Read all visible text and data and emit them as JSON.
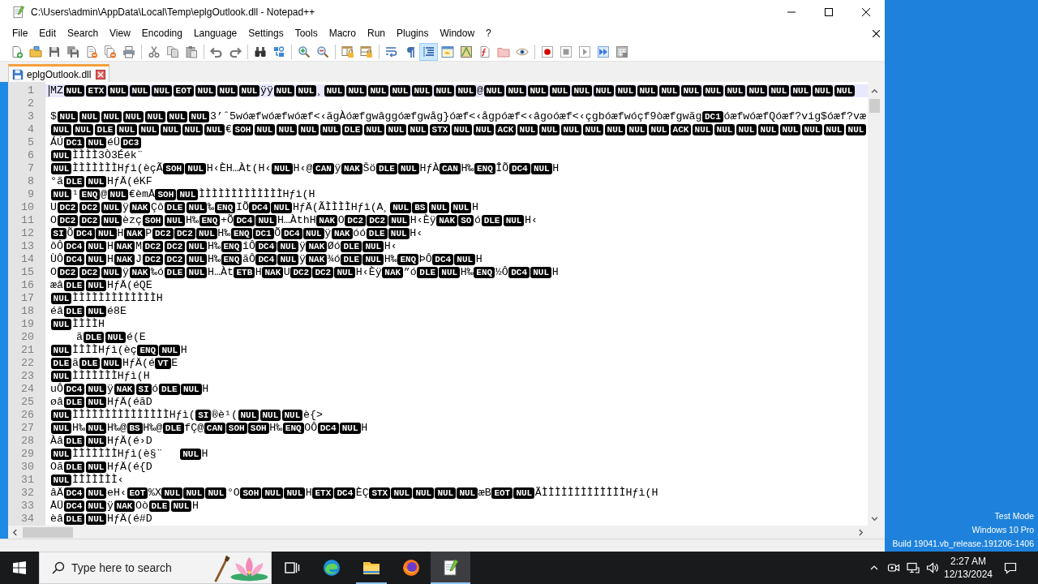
{
  "window": {
    "title": "C:\\Users\\admin\\AppData\\Local\\Temp\\eplgOutlook.dll - Notepad++"
  },
  "menu": [
    "File",
    "Edit",
    "Search",
    "View",
    "Encoding",
    "Language",
    "Settings",
    "Tools",
    "Macro",
    "Run",
    "Plugins",
    "Window",
    "?"
  ],
  "toolbar": [
    {
      "on": false
    },
    {
      "on": false
    },
    {
      "on": false
    },
    {
      "on": false
    },
    {
      "on": false
    },
    {
      "on": false
    },
    {
      "on": false
    },
    {
      "on": false
    },
    {
      "on": false
    },
    {
      "on": false
    },
    {
      "on": false
    },
    {
      "on": false
    },
    {
      "on": false
    },
    {
      "on": false
    },
    {
      "on": false
    },
    {
      "on": false
    },
    {
      "on": false
    },
    {
      "on": false
    },
    {
      "on": false
    },
    {
      "on": false
    },
    {
      "on": true
    },
    {
      "on": false
    },
    {
      "on": false
    },
    {
      "on": false
    },
    {
      "on": false
    },
    {
      "on": false
    },
    {
      "on": false
    },
    {
      "on": false
    },
    {
      "on": false
    },
    {
      "on": false
    },
    {
      "on": false
    }
  ],
  "tabs": [
    {
      "label": "eplgOutlook.dll",
      "selected": true
    }
  ],
  "editor": {
    "lines": [
      {
        "number": "1",
        "current": true,
        "segments": [
          {
            "kind": "text",
            "text": "MZ"
          },
          {
            "kind": "ctrl",
            "text": "NUL"
          },
          {
            "kind": "ctrl",
            "text": "ETX"
          },
          {
            "kind": "ctrl",
            "text": "NUL"
          },
          {
            "kind": "ctrl",
            "text": "NUL"
          },
          {
            "kind": "ctrl",
            "text": "NUL"
          },
          {
            "kind": "ctrl",
            "text": "EOT"
          },
          {
            "kind": "ctrl",
            "text": "NUL"
          },
          {
            "kind": "ctrl",
            "text": "NUL"
          },
          {
            "kind": "ctrl",
            "text": "NUL"
          },
          {
            "kind": "text",
            "text": "ÿÿ"
          },
          {
            "kind": "ctrl",
            "text": "NUL"
          },
          {
            "kind": "ctrl",
            "text": "NUL"
          },
          {
            "kind": "text",
            "text": "¸"
          },
          {
            "kind": "ctrl",
            "text": "NUL"
          },
          {
            "kind": "ctrl",
            "text": "NUL"
          },
          {
            "kind": "ctrl",
            "text": "NUL"
          },
          {
            "kind": "ctrl",
            "text": "NUL"
          },
          {
            "kind": "ctrl",
            "text": "NUL"
          },
          {
            "kind": "ctrl",
            "text": "NUL"
          },
          {
            "kind": "ctrl",
            "text": "NUL"
          },
          {
            "kind": "text",
            "text": "@"
          },
          {
            "kind": "ctrl",
            "text": "NUL"
          },
          {
            "kind": "ctrl",
            "text": "NUL"
          },
          {
            "kind": "ctrl",
            "text": "NUL"
          },
          {
            "kind": "ctrl",
            "text": "NUL"
          },
          {
            "kind": "ctrl",
            "text": "NUL"
          },
          {
            "kind": "ctrl",
            "text": "NUL"
          },
          {
            "kind": "ctrl",
            "text": "NUL"
          },
          {
            "kind": "ctrl",
            "text": "NUL"
          },
          {
            "kind": "ctrl",
            "text": "NUL"
          },
          {
            "kind": "ctrl",
            "text": "NUL"
          },
          {
            "kind": "ctrl",
            "text": "NUL"
          },
          {
            "kind": "ctrl",
            "text": "NUL"
          },
          {
            "kind": "ctrl",
            "text": "NUL"
          },
          {
            "kind": "ctrl",
            "text": "NUL"
          },
          {
            "kind": "ctrl",
            "text": "NUL"
          },
          {
            "kind": "ctrl",
            "text": "NUL"
          },
          {
            "kind": "ctrl",
            "text": "NUL"
          }
        ]
      },
      {
        "number": "2",
        "current": false
      },
      {
        "number": "3",
        "current": false,
        "segments": [
          {
            "kind": "text",
            "text": "$"
          },
          {
            "kind": "ctrl",
            "text": "NUL"
          },
          {
            "kind": "ctrl",
            "text": "NUL"
          },
          {
            "kind": "ctrl",
            "text": "NUL"
          },
          {
            "kind": "ctrl",
            "text": "NUL"
          },
          {
            "kind": "ctrl",
            "text": "NUL"
          },
          {
            "kind": "ctrl",
            "text": "NUL"
          },
          {
            "kind": "ctrl",
            "text": "NUL"
          },
          {
            "kind": "text",
            "text": "3’ˆ5wóæfwóæfwóæf<‹ãgÀóæfgwâggóæfgwåg}óæf<‹ågpóæf<‹âgoóæf<‹çgbóæfwóçf9òæfgwãg"
          },
          {
            "kind": "ctrl",
            "text": "DC1"
          },
          {
            "kind": "text",
            "text": "óæfwóæfQóæf?vig$óæf?væ"
          }
        ]
      },
      {
        "number": "4",
        "current": false,
        "segments": [
          {
            "kind": "ctrl",
            "text": "NUL"
          },
          {
            "kind": "ctrl",
            "text": "NUL"
          },
          {
            "kind": "ctrl",
            "text": "DLE"
          },
          {
            "kind": "ctrl",
            "text": "NUL"
          },
          {
            "kind": "ctrl",
            "text": "NUL"
          },
          {
            "kind": "ctrl",
            "text": "NUL"
          },
          {
            "kind": "ctrl",
            "text": "NUL"
          },
          {
            "kind": "ctrl",
            "text": "NUL"
          },
          {
            "kind": "text",
            "text": "€"
          },
          {
            "kind": "ctrl",
            "text": "SOH"
          },
          {
            "kind": "ctrl",
            "text": "NUL"
          },
          {
            "kind": "ctrl",
            "text": "NUL"
          },
          {
            "kind": "ctrl",
            "text": "NUL"
          },
          {
            "kind": "ctrl",
            "text": "NUL"
          },
          {
            "kind": "ctrl",
            "text": "DLE"
          },
          {
            "kind": "ctrl",
            "text": "NUL"
          },
          {
            "kind": "ctrl",
            "text": "NUL"
          },
          {
            "kind": "ctrl",
            "text": "NUL"
          },
          {
            "kind": "ctrl",
            "text": "STX"
          },
          {
            "kind": "ctrl",
            "text": "NUL"
          },
          {
            "kind": "ctrl",
            "text": "NUL"
          },
          {
            "kind": "ctrl",
            "text": "ACK"
          },
          {
            "kind": "ctrl",
            "text": "NUL"
          },
          {
            "kind": "ctrl",
            "text": "NUL"
          },
          {
            "kind": "ctrl",
            "text": "NUL"
          },
          {
            "kind": "ctrl",
            "text": "NUL"
          },
          {
            "kind": "ctrl",
            "text": "NUL"
          },
          {
            "kind": "ctrl",
            "text": "NUL"
          },
          {
            "kind": "ctrl",
            "text": "NUL"
          },
          {
            "kind": "ctrl",
            "text": "ACK"
          },
          {
            "kind": "ctrl",
            "text": "NUL"
          },
          {
            "kind": "ctrl",
            "text": "NUL"
          },
          {
            "kind": "ctrl",
            "text": "NUL"
          },
          {
            "kind": "ctrl",
            "text": "NUL"
          },
          {
            "kind": "ctrl",
            "text": "NUL"
          },
          {
            "kind": "ctrl",
            "text": "NUL"
          },
          {
            "kind": "ctrl",
            "text": "NUL"
          },
          {
            "kind": "ctrl",
            "text": "NUL"
          }
        ]
      },
      {
        "number": "5",
        "current": false,
        "segments": [
          {
            "kind": "text",
            "text": "ÁÚ"
          },
          {
            "kind": "ctrl",
            "text": "DC1"
          },
          {
            "kind": "ctrl",
            "text": "NUL"
          },
          {
            "kind": "text",
            "text": "éÜ"
          },
          {
            "kind": "ctrl",
            "text": "DC3"
          }
        ]
      },
      {
        "number": "6",
        "current": false,
        "segments": [
          {
            "kind": "ctrl",
            "text": "NUL"
          },
          {
            "kind": "text",
            "text": "ÌÌÌÌ3Ò3Éék¨"
          }
        ]
      },
      {
        "number": "7",
        "current": false,
        "segments": [
          {
            "kind": "ctrl",
            "text": "NUL"
          },
          {
            "kind": "text",
            "text": "ÌÌÌÌÌÌÌHƒì(èçÃ"
          },
          {
            "kind": "ctrl",
            "text": "SOH"
          },
          {
            "kind": "ctrl",
            "text": "NUL"
          },
          {
            "kind": "text",
            "text": "H‹ÈH…Àt(H‹"
          },
          {
            "kind": "ctrl",
            "text": "NUL"
          },
          {
            "kind": "text",
            "text": "H‹@"
          },
          {
            "kind": "ctrl",
            "text": "CAN"
          },
          {
            "kind": "text",
            "text": "ÿ"
          },
          {
            "kind": "ctrl",
            "text": "NAK"
          },
          {
            "kind": "text",
            "text": "Šö"
          },
          {
            "kind": "ctrl",
            "text": "DLE"
          },
          {
            "kind": "ctrl",
            "text": "NUL"
          },
          {
            "kind": "text",
            "text": "HƒÀ"
          },
          {
            "kind": "ctrl",
            "text": "CAN"
          },
          {
            "kind": "text",
            "text": "H‰"
          },
          {
            "kind": "ctrl",
            "text": "ENQ"
          },
          {
            "kind": "text",
            "text": "ÎÕ"
          },
          {
            "kind": "ctrl",
            "text": "DC4"
          },
          {
            "kind": "ctrl",
            "text": "NUL"
          },
          {
            "kind": "text",
            "text": "H"
          }
        ]
      },
      {
        "number": "8",
        "current": false,
        "segments": [
          {
            "kind": "text",
            "text": "°ã"
          },
          {
            "kind": "ctrl",
            "text": "DLE"
          },
          {
            "kind": "ctrl",
            "text": "NUL"
          },
          {
            "kind": "text",
            "text": "HƒÄ(éKF"
          }
        ]
      },
      {
        "number": "9",
        "current": false,
        "segments": [
          {
            "kind": "ctrl",
            "text": "NUL"
          },
          {
            "kind": "text",
            "text": "¹"
          },
          {
            "kind": "ctrl",
            "text": "ENQ"
          },
          {
            "kind": "text",
            "text": "@"
          },
          {
            "kind": "ctrl",
            "text": "NUL"
          },
          {
            "kind": "text",
            "text": "€èmÅ"
          },
          {
            "kind": "ctrl",
            "text": "SOH"
          },
          {
            "kind": "ctrl",
            "text": "NUL"
          },
          {
            "kind": "text",
            "text": "ÌÌÌÌÌÌÌÌÌÌÌÌÌHƒì(H"
          }
        ]
      },
      {
        "number": "10",
        "current": false,
        "segments": [
          {
            "kind": "text",
            "text": "U"
          },
          {
            "kind": "ctrl",
            "text": "DC2"
          },
          {
            "kind": "ctrl",
            "text": "DC2"
          },
          {
            "kind": "ctrl",
            "text": "NUL"
          },
          {
            "kind": "text",
            "text": "ÿ"
          },
          {
            "kind": "ctrl",
            "text": "NAK"
          },
          {
            "kind": "text",
            "text": "Çô"
          },
          {
            "kind": "ctrl",
            "text": "DLE"
          },
          {
            "kind": "ctrl",
            "text": "NUL"
          },
          {
            "kind": "text",
            "text": "‰"
          },
          {
            "kind": "ctrl",
            "text": "ENQ"
          },
          {
            "kind": "text",
            "text": "IÕ"
          },
          {
            "kind": "ctrl",
            "text": "DC4"
          },
          {
            "kind": "ctrl",
            "text": "NUL"
          },
          {
            "kind": "text",
            "text": "HƒÄ(ÃÌÌÌÌHƒì(A¸"
          },
          {
            "kind": "ctrl",
            "text": "NUL"
          },
          {
            "kind": "ctrl",
            "text": "BS"
          },
          {
            "kind": "ctrl",
            "text": "NUL"
          },
          {
            "kind": "ctrl",
            "text": "NUL"
          },
          {
            "kind": "text",
            "text": "H"
          }
        ]
      },
      {
        "number": "11",
        "current": false,
        "segments": [
          {
            "kind": "text",
            "text": "O"
          },
          {
            "kind": "ctrl",
            "text": "DC2"
          },
          {
            "kind": "ctrl",
            "text": "DC2"
          },
          {
            "kind": "ctrl",
            "text": "NUL"
          },
          {
            "kind": "text",
            "text": "èzç"
          },
          {
            "kind": "ctrl",
            "text": "SOH"
          },
          {
            "kind": "ctrl",
            "text": "NUL"
          },
          {
            "kind": "text",
            "text": "H‰"
          },
          {
            "kind": "ctrl",
            "text": "ENQ"
          },
          {
            "kind": "text",
            "text": "+Õ"
          },
          {
            "kind": "ctrl",
            "text": "DC4"
          },
          {
            "kind": "ctrl",
            "text": "NUL"
          },
          {
            "kind": "text",
            "text": "H…ÀthH"
          },
          {
            "kind": "ctrl",
            "text": "NAK"
          },
          {
            "kind": "text",
            "text": "O"
          },
          {
            "kind": "ctrl",
            "text": "DC2"
          },
          {
            "kind": "ctrl",
            "text": "DC2"
          },
          {
            "kind": "ctrl",
            "text": "NUL"
          },
          {
            "kind": "text",
            "text": "H‹Èÿ"
          },
          {
            "kind": "ctrl",
            "text": "NAK"
          },
          {
            "kind": "ctrl",
            "text": "SO"
          },
          {
            "kind": "text",
            "text": "ó"
          },
          {
            "kind": "ctrl",
            "text": "DLE"
          },
          {
            "kind": "ctrl",
            "text": "NUL"
          },
          {
            "kind": "text",
            "text": "H‹"
          }
        ]
      },
      {
        "number": "12",
        "current": false,
        "segments": [
          {
            "kind": "ctrl",
            "text": "SI"
          },
          {
            "kind": "text",
            "text": "Õ"
          },
          {
            "kind": "ctrl",
            "text": "DC4"
          },
          {
            "kind": "ctrl",
            "text": "NUL"
          },
          {
            "kind": "text",
            "text": "H"
          },
          {
            "kind": "ctrl",
            "text": "NAK"
          },
          {
            "kind": "text",
            "text": "P"
          },
          {
            "kind": "ctrl",
            "text": "DC2"
          },
          {
            "kind": "ctrl",
            "text": "DC2"
          },
          {
            "kind": "ctrl",
            "text": "NUL"
          },
          {
            "kind": "text",
            "text": "H‰"
          },
          {
            "kind": "ctrl",
            "text": "ENQ"
          },
          {
            "kind": "ctrl",
            "text": "DC1"
          },
          {
            "kind": "text",
            "text": "Õ"
          },
          {
            "kind": "ctrl",
            "text": "DC4"
          },
          {
            "kind": "ctrl",
            "text": "NUL"
          },
          {
            "kind": "text",
            "text": "ÿ"
          },
          {
            "kind": "ctrl",
            "text": "NAK"
          },
          {
            "kind": "text",
            "text": "óó"
          },
          {
            "kind": "ctrl",
            "text": "DLE"
          },
          {
            "kind": "ctrl",
            "text": "NUL"
          },
          {
            "kind": "text",
            "text": "H‹"
          }
        ]
      },
      {
        "number": "13",
        "current": false,
        "segments": [
          {
            "kind": "text",
            "text": "ôÔ"
          },
          {
            "kind": "ctrl",
            "text": "DC4"
          },
          {
            "kind": "ctrl",
            "text": "NUL"
          },
          {
            "kind": "text",
            "text": "H"
          },
          {
            "kind": "ctrl",
            "text": "NAK"
          },
          {
            "kind": "text",
            "text": "M"
          },
          {
            "kind": "ctrl",
            "text": "DC2"
          },
          {
            "kind": "ctrl",
            "text": "DC2"
          },
          {
            "kind": "ctrl",
            "text": "NUL"
          },
          {
            "kind": "text",
            "text": "H‰"
          },
          {
            "kind": "ctrl",
            "text": "ENQ"
          },
          {
            "kind": "text",
            "text": "îÔ"
          },
          {
            "kind": "ctrl",
            "text": "DC4"
          },
          {
            "kind": "ctrl",
            "text": "NUL"
          },
          {
            "kind": "text",
            "text": "ÿ"
          },
          {
            "kind": "ctrl",
            "text": "NAK"
          },
          {
            "kind": "text",
            "text": "Øó"
          },
          {
            "kind": "ctrl",
            "text": "DLE"
          },
          {
            "kind": "ctrl",
            "text": "NUL"
          },
          {
            "kind": "text",
            "text": "H‹"
          }
        ]
      },
      {
        "number": "14",
        "current": false,
        "segments": [
          {
            "kind": "text",
            "text": "ÙÔ"
          },
          {
            "kind": "ctrl",
            "text": "DC4"
          },
          {
            "kind": "ctrl",
            "text": "NUL"
          },
          {
            "kind": "text",
            "text": "H"
          },
          {
            "kind": "ctrl",
            "text": "NAK"
          },
          {
            "kind": "text",
            "text": "J"
          },
          {
            "kind": "ctrl",
            "text": "DC2"
          },
          {
            "kind": "ctrl",
            "text": "DC2"
          },
          {
            "kind": "ctrl",
            "text": "NUL"
          },
          {
            "kind": "text",
            "text": "H‰"
          },
          {
            "kind": "ctrl",
            "text": "ENQ"
          },
          {
            "kind": "text",
            "text": "ãÔ"
          },
          {
            "kind": "ctrl",
            "text": "DC4"
          },
          {
            "kind": "ctrl",
            "text": "NUL"
          },
          {
            "kind": "text",
            "text": "ÿ"
          },
          {
            "kind": "ctrl",
            "text": "NAK"
          },
          {
            "kind": "text",
            "text": "¾ó"
          },
          {
            "kind": "ctrl",
            "text": "DLE"
          },
          {
            "kind": "ctrl",
            "text": "NUL"
          },
          {
            "kind": "text",
            "text": "H‰"
          },
          {
            "kind": "ctrl",
            "text": "ENQ"
          },
          {
            "kind": "text",
            "text": "ÞÔ"
          },
          {
            "kind": "ctrl",
            "text": "DC4"
          },
          {
            "kind": "ctrl",
            "text": "NUL"
          },
          {
            "kind": "text",
            "text": "H"
          }
        ]
      },
      {
        "number": "15",
        "current": false,
        "segments": [
          {
            "kind": "text",
            "text": "O"
          },
          {
            "kind": "ctrl",
            "text": "DC2"
          },
          {
            "kind": "ctrl",
            "text": "DC2"
          },
          {
            "kind": "ctrl",
            "text": "NUL"
          },
          {
            "kind": "text",
            "text": "ÿ"
          },
          {
            "kind": "ctrl",
            "text": "NAK"
          },
          {
            "kind": "text",
            "text": "‰ó"
          },
          {
            "kind": "ctrl",
            "text": "DLE"
          },
          {
            "kind": "ctrl",
            "text": "NUL"
          },
          {
            "kind": "text",
            "text": "H…Àt"
          },
          {
            "kind": "ctrl",
            "text": "ETB"
          },
          {
            "kind": "text",
            "text": "H"
          },
          {
            "kind": "ctrl",
            "text": "NAK"
          },
          {
            "kind": "text",
            "text": "U"
          },
          {
            "kind": "ctrl",
            "text": "DC2"
          },
          {
            "kind": "ctrl",
            "text": "DC2"
          },
          {
            "kind": "ctrl",
            "text": "NUL"
          },
          {
            "kind": "text",
            "text": "H‹Èÿ"
          },
          {
            "kind": "ctrl",
            "text": "NAK"
          },
          {
            "kind": "text",
            "text": "”ó"
          },
          {
            "kind": "ctrl",
            "text": "DLE"
          },
          {
            "kind": "ctrl",
            "text": "NUL"
          },
          {
            "kind": "text",
            "text": "H‰"
          },
          {
            "kind": "ctrl",
            "text": "ENQ"
          },
          {
            "kind": "text",
            "text": "½Ô"
          },
          {
            "kind": "ctrl",
            "text": "DC4"
          },
          {
            "kind": "ctrl",
            "text": "NUL"
          },
          {
            "kind": "text",
            "text": "H"
          }
        ]
      },
      {
        "number": "16",
        "current": false,
        "segments": [
          {
            "kind": "text",
            "text": "æâ"
          },
          {
            "kind": "ctrl",
            "text": "DLE"
          },
          {
            "kind": "ctrl",
            "text": "NUL"
          },
          {
            "kind": "text",
            "text": "HƒÄ(éQE"
          }
        ]
      },
      {
        "number": "17",
        "current": false,
        "segments": [
          {
            "kind": "ctrl",
            "text": "NUL"
          },
          {
            "kind": "text",
            "text": "ÌÌÌÌÌÌÌÌÌÌÌÌÌH"
          }
        ]
      },
      {
        "number": "18",
        "current": false,
        "segments": [
          {
            "kind": "text",
            "text": "éâ"
          },
          {
            "kind": "ctrl",
            "text": "DLE"
          },
          {
            "kind": "ctrl",
            "text": "NUL"
          },
          {
            "kind": "text",
            "text": "é8E"
          }
        ]
      },
      {
        "number": "19",
        "current": false,
        "segments": [
          {
            "kind": "ctrl",
            "text": "NUL"
          },
          {
            "kind": "text",
            "text": "ÌÌÌÌH"
          }
        ]
      },
      {
        "number": "20",
        "current": false,
        "segments": [
          {
            "kind": "text",
            "text": "\tã"
          },
          {
            "kind": "ctrl",
            "text": "DLE"
          },
          {
            "kind": "ctrl",
            "text": "NUL"
          },
          {
            "kind": "text",
            "text": "é(E"
          }
        ]
      },
      {
        "number": "21",
        "current": false,
        "segments": [
          {
            "kind": "ctrl",
            "text": "NUL"
          },
          {
            "kind": "text",
            "text": "ÌÌÌÌHƒì(èç"
          },
          {
            "kind": "ctrl",
            "text": "ENQ"
          },
          {
            "kind": "ctrl",
            "text": "NUL"
          },
          {
            "kind": "text",
            "text": "H"
          }
        ]
      },
      {
        "number": "22",
        "current": false,
        "segments": [
          {
            "kind": "ctrl",
            "text": "DLE"
          },
          {
            "kind": "text",
            "text": "ã"
          },
          {
            "kind": "ctrl",
            "text": "DLE"
          },
          {
            "kind": "ctrl",
            "text": "NUL"
          },
          {
            "kind": "text",
            "text": "HƒÄ(é"
          },
          {
            "kind": "ctrl",
            "text": "VT"
          },
          {
            "kind": "text",
            "text": "E"
          }
        ]
      },
      {
        "number": "23",
        "current": false,
        "segments": [
          {
            "kind": "ctrl",
            "text": "NUL"
          },
          {
            "kind": "text",
            "text": "ÌÌÌÌÌÌÌHƒì(H"
          }
        ]
      },
      {
        "number": "24",
        "current": false,
        "segments": [
          {
            "kind": "text",
            "text": "uÔ"
          },
          {
            "kind": "ctrl",
            "text": "DC4"
          },
          {
            "kind": "ctrl",
            "text": "NUL"
          },
          {
            "kind": "text",
            "text": "ÿ"
          },
          {
            "kind": "ctrl",
            "text": "NAK"
          },
          {
            "kind": "ctrl",
            "text": "SI"
          },
          {
            "kind": "text",
            "text": "ó"
          },
          {
            "kind": "ctrl",
            "text": "DLE"
          },
          {
            "kind": "ctrl",
            "text": "NUL"
          },
          {
            "kind": "text",
            "text": "H"
          }
        ]
      },
      {
        "number": "25",
        "current": false,
        "segments": [
          {
            "kind": "text",
            "text": "øâ"
          },
          {
            "kind": "ctrl",
            "text": "DLE"
          },
          {
            "kind": "ctrl",
            "text": "NUL"
          },
          {
            "kind": "text",
            "text": "HƒÄ(éãD"
          }
        ]
      },
      {
        "number": "26",
        "current": false,
        "segments": [
          {
            "kind": "ctrl",
            "text": "NUL"
          },
          {
            "kind": "text",
            "text": "ÌÌÌÌÌÌÌÌÌÌÌÌÌÌÌHƒì("
          },
          {
            "kind": "ctrl",
            "text": "SI"
          },
          {
            "kind": "text",
            "text": "®è¹("
          },
          {
            "kind": "ctrl",
            "text": "NUL"
          },
          {
            "kind": "ctrl",
            "text": "NUL"
          },
          {
            "kind": "ctrl",
            "text": "NUL"
          },
          {
            "kind": "text",
            "text": "è{>"
          }
        ]
      },
      {
        "number": "27",
        "current": false,
        "segments": [
          {
            "kind": "ctrl",
            "text": "NUL"
          },
          {
            "kind": "text",
            "text": "H‰"
          },
          {
            "kind": "ctrl",
            "text": "NUL"
          },
          {
            "kind": "text",
            "text": "H‰@"
          },
          {
            "kind": "ctrl",
            "text": "BS"
          },
          {
            "kind": "text",
            "text": "H‰@"
          },
          {
            "kind": "ctrl",
            "text": "DLE"
          },
          {
            "kind": "text",
            "text": "fÇ@"
          },
          {
            "kind": "ctrl",
            "text": "CAN"
          },
          {
            "kind": "ctrl",
            "text": "SOH"
          },
          {
            "kind": "ctrl",
            "text": "SOH"
          },
          {
            "kind": "text",
            "text": "H‰"
          },
          {
            "kind": "ctrl",
            "text": "ENQ"
          },
          {
            "kind": "text",
            "text": "OÔ"
          },
          {
            "kind": "ctrl",
            "text": "DC4"
          },
          {
            "kind": "ctrl",
            "text": "NUL"
          },
          {
            "kind": "text",
            "text": "H"
          }
        ]
      },
      {
        "number": "28",
        "current": false,
        "segments": [
          {
            "kind": "text",
            "text": "Àâ"
          },
          {
            "kind": "ctrl",
            "text": "DLE"
          },
          {
            "kind": "ctrl",
            "text": "NUL"
          },
          {
            "kind": "text",
            "text": "HƒÄ(é›D"
          }
        ]
      },
      {
        "number": "29",
        "current": false,
        "segments": [
          {
            "kind": "ctrl",
            "text": "NUL"
          },
          {
            "kind": "text",
            "text": "ÌÌÌÌÌÌÌHƒì(è§¨\t"
          },
          {
            "kind": "ctrl",
            "text": "NUL"
          },
          {
            "kind": "text",
            "text": "H"
          }
        ]
      },
      {
        "number": "30",
        "current": false,
        "segments": [
          {
            "kind": "text",
            "text": "Oã"
          },
          {
            "kind": "ctrl",
            "text": "DLE"
          },
          {
            "kind": "ctrl",
            "text": "NUL"
          },
          {
            "kind": "text",
            "text": "HƒÄ(é{D"
          }
        ]
      },
      {
        "number": "31",
        "current": false,
        "segments": [
          {
            "kind": "ctrl",
            "text": "NUL"
          },
          {
            "kind": "text",
            "text": "ÌÌÌÌÌÌÌ‹"
          }
        ]
      },
      {
        "number": "32",
        "current": false,
        "segments": [
          {
            "kind": "text",
            "text": "âÄ"
          },
          {
            "kind": "ctrl",
            "text": "DC4"
          },
          {
            "kind": "ctrl",
            "text": "NUL"
          },
          {
            "kind": "text",
            "text": "eH‹"
          },
          {
            "kind": "ctrl",
            "text": "EOT"
          },
          {
            "kind": "text",
            "text": "%X"
          },
          {
            "kind": "ctrl",
            "text": "NUL"
          },
          {
            "kind": "ctrl",
            "text": "NUL"
          },
          {
            "kind": "ctrl",
            "text": "NUL"
          },
          {
            "kind": "text",
            "text": "°O"
          },
          {
            "kind": "ctrl",
            "text": "SOH"
          },
          {
            "kind": "ctrl",
            "text": "NUL"
          },
          {
            "kind": "ctrl",
            "text": "NUL"
          },
          {
            "kind": "text",
            "text": "H"
          },
          {
            "kind": "ctrl",
            "text": "ETX"
          },
          {
            "kind": "ctrl",
            "text": "DC4"
          },
          {
            "kind": "text",
            "text": "ÈÇ"
          },
          {
            "kind": "ctrl",
            "text": "STX"
          },
          {
            "kind": "ctrl",
            "text": "NUL"
          },
          {
            "kind": "ctrl",
            "text": "NUL"
          },
          {
            "kind": "ctrl",
            "text": "NUL"
          },
          {
            "kind": "ctrl",
            "text": "NUL"
          },
          {
            "kind": "text",
            "text": "æB"
          },
          {
            "kind": "ctrl",
            "text": "EOT"
          },
          {
            "kind": "ctrl",
            "text": "NUL"
          },
          {
            "kind": "text",
            "text": "ÃÌÌÌÌÌÌÌÌÌÌÌÌÌHƒì(H"
          }
        ]
      },
      {
        "number": "33",
        "current": false,
        "segments": [
          {
            "kind": "text",
            "text": "ÅÜ"
          },
          {
            "kind": "ctrl",
            "text": "DC4"
          },
          {
            "kind": "ctrl",
            "text": "NUL"
          },
          {
            "kind": "text",
            "text": "ÿ"
          },
          {
            "kind": "ctrl",
            "text": "NAK"
          },
          {
            "kind": "text",
            "text": "Oò"
          },
          {
            "kind": "ctrl",
            "text": "DLE"
          },
          {
            "kind": "ctrl",
            "text": "NUL"
          },
          {
            "kind": "text",
            "text": "H"
          }
        ]
      },
      {
        "number": "34",
        "current": false,
        "segments": [
          {
            "kind": "text",
            "text": "èâ"
          },
          {
            "kind": "ctrl",
            "text": "DLE"
          },
          {
            "kind": "ctrl",
            "text": "NUL"
          },
          {
            "kind": "text",
            "text": "HƒÄ(é#D"
          }
        ]
      }
    ]
  },
  "desktop": {
    "edition_notice": [
      "Test Mode",
      "Windows 10 Pro",
      "Build 19041.vb_release.191206-1406"
    ]
  },
  "taskbar": {
    "search": {
      "placeholder": "Type here to search"
    },
    "apps": [
      {
        "active": false,
        "running": false
      },
      {
        "active": false,
        "running": true
      },
      {
        "active": false,
        "running": false
      },
      {
        "active": true,
        "running": true
      }
    ],
    "clock": {
      "time": "2:27 AM",
      "date": "12/13/2024"
    }
  }
}
